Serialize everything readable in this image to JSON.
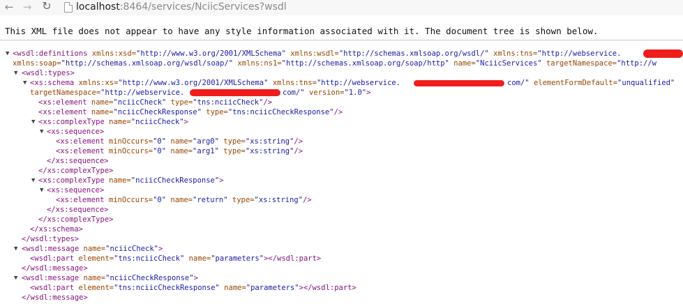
{
  "browser": {
    "url_host": "localhost",
    "url_rest": ":8464/services/NciicServices?wsdl"
  },
  "notice": "This XML file does not appear to have any style information associated with it. The document tree is shown below.",
  "xml": {
    "l1_tag": "<wsdl:definitions",
    "l1_a1n": "xmlns:xsd=",
    "l1_a1v": "\"http://www.w3.org/2001/XMLSchema\"",
    "l1_a2n": "xmlns:wsdl=",
    "l1_a2v": "\"http://schemas.xmlsoap.org/wsdl/\"",
    "l1_a3n": "xmlns:tns=",
    "l1_a3v": "\"http://webservice.",
    "l2_a1n": "xmlns:soap=",
    "l2_a1v": "\"http://schemas.xmlsoap.org/wsdl/soap/\"",
    "l2_a2n": "xmlns:ns1=",
    "l2_a2v": "\"http://schemas.xmlsoap.org/soap/http\"",
    "l2_a3n": "name=",
    "l2_a3v": "\"NciicServices\"",
    "l2_a4n": "targetNamespace=",
    "l2_a4v": "\"http://w",
    "l3_tag": "<wsdl:types>",
    "l4_tag": "<xs:schema",
    "l4_a1n": "xmlns:xs=",
    "l4_a1v": "\"http://www.w3.org/2001/XMLSchema\"",
    "l4_a2n": "xmlns:tns=",
    "l4_a2v": "\"http://webservice.",
    "l4_a2v_end": "com/\"",
    "l4_a3n": "elementFormDefault=",
    "l4_a3v": "\"unqualified\"",
    "l5_a1n": "targetNamespace=",
    "l5_a1v": "\"http://webservice.",
    "l5_a1v_end": "com/\"",
    "l5_a2n": "version=",
    "l5_a2v": "\"1.0\"",
    "l5_end": ">",
    "l6_tag": "<xs:element",
    "l6_a1n": "name=",
    "l6_a1v": "\"nciicCheck\"",
    "l6_a2n": "type=",
    "l6_a2v": "\"tns:nciicCheck\"",
    "l6_end": "/>",
    "l7_tag": "<xs:element",
    "l7_a1n": "name=",
    "l7_a1v": "\"nciicCheckResponse\"",
    "l7_a2n": "type=",
    "l7_a2v": "\"tns:nciicCheckResponse\"",
    "l7_end": "/>",
    "l8_tag": "<xs:complexType",
    "l8_a1n": "name=",
    "l8_a1v": "\"nciicCheck\"",
    "l8_end": ">",
    "l9_tag": "<xs:sequence>",
    "l10_tag": "<xs:element",
    "l10_a1n": "minOccurs=",
    "l10_a1v": "\"0\"",
    "l10_a2n": "name=",
    "l10_a2v": "\"arg0\"",
    "l10_a3n": "type=",
    "l10_a3v": "\"xs:string\"",
    "l10_end": "/>",
    "l11_tag": "<xs:element",
    "l11_a1n": "minOccurs=",
    "l11_a1v": "\"0\"",
    "l11_a2n": "name=",
    "l11_a2v": "\"arg1\"",
    "l11_a3n": "type=",
    "l11_a3v": "\"xs:string\"",
    "l11_end": "/>",
    "l12_tag": "</xs:sequence>",
    "l13_tag": "</xs:complexType>",
    "l14_tag": "<xs:complexType",
    "l14_a1n": "name=",
    "l14_a1v": "\"nciicCheckResponse\"",
    "l14_end": ">",
    "l15_tag": "<xs:sequence>",
    "l16_tag": "<xs:element",
    "l16_a1n": "minOccurs=",
    "l16_a1v": "\"0\"",
    "l16_a2n": "name=",
    "l16_a2v": "\"return\"",
    "l16_a3n": "type=",
    "l16_a3v": "\"xs:string\"",
    "l16_end": "/>",
    "l17_tag": "</xs:sequence>",
    "l18_tag": "</xs:complexType>",
    "l19_tag": "</xs:schema>",
    "l20_tag": "</wsdl:types>",
    "l21_tag": "<wsdl:message",
    "l21_a1n": "name=",
    "l21_a1v": "\"nciicCheck\"",
    "l21_end": ">",
    "l22_tag": "<wsdl:part",
    "l22_a1n": "element=",
    "l22_a1v": "\"tns:nciicCheck\"",
    "l22_a2n": "name=",
    "l22_a2v": "\"parameters\"",
    "l22_end": "></wsdl:part>",
    "l23_tag": "</wsdl:message>",
    "l24_tag": "<wsdl:message",
    "l24_a1n": "name=",
    "l24_a1v": "\"nciicCheckResponse\"",
    "l24_end": ">",
    "l25_tag": "<wsdl:part",
    "l25_a1n": "element=",
    "l25_a1v": "\"tns:nciicCheckResponse\"",
    "l25_a2n": "name=",
    "l25_a2v": "\"parameters\"",
    "l25_end": "></wsdl:part>",
    "l26_tag": "</wsdl:message>"
  },
  "icons": {
    "back": "back-arrow-icon",
    "forward": "forward-arrow-icon",
    "reload": "reload-icon",
    "page": "page-icon",
    "expanded": "expanded-triangle-icon"
  },
  "colors": {
    "tag": "#881280",
    "attr_name": "#994500",
    "attr_value": "#1a1aa6",
    "redaction": "#f01d1d"
  }
}
